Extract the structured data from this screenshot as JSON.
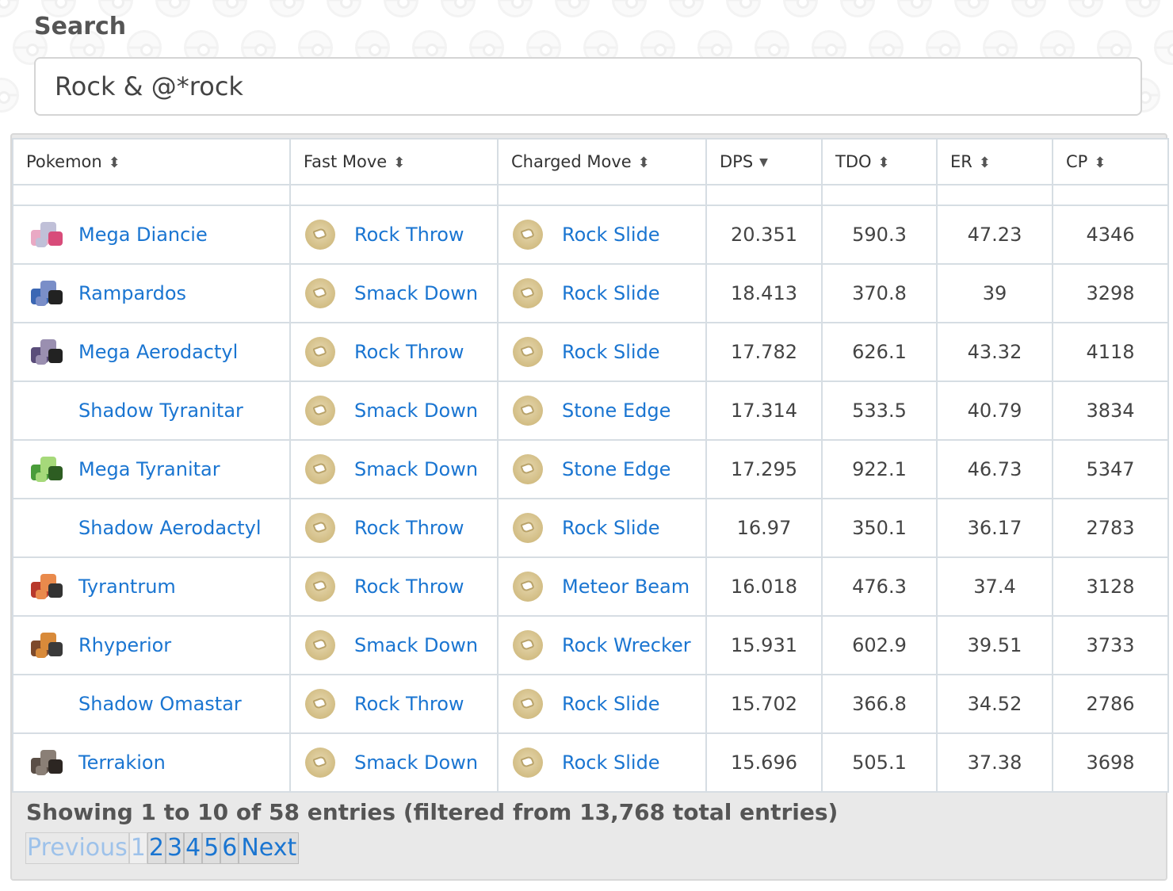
{
  "search": {
    "label": "Search",
    "value": "Rock & @*rock"
  },
  "table": {
    "headers": [
      {
        "label": "Pokemon",
        "sort": "both"
      },
      {
        "label": "Fast Move",
        "sort": "both"
      },
      {
        "label": "Charged Move",
        "sort": "both"
      },
      {
        "label": "DPS",
        "sort": "desc"
      },
      {
        "label": "TDO",
        "sort": "both"
      },
      {
        "label": "ER",
        "sort": "both"
      },
      {
        "label": "CP",
        "sort": "both"
      }
    ],
    "move_type_icon": "rock-type-icon",
    "rows": [
      {
        "pokemon": "Mega Diancie",
        "sprite": true,
        "fast": "Rock Throw",
        "charged": "Rock Slide",
        "dps": "20.351",
        "tdo": "590.3",
        "er": "47.23",
        "cp": "4346"
      },
      {
        "pokemon": "Rampardos",
        "sprite": true,
        "fast": "Smack Down",
        "charged": "Rock Slide",
        "dps": "18.413",
        "tdo": "370.8",
        "er": "39",
        "cp": "3298"
      },
      {
        "pokemon": "Mega Aerodactyl",
        "sprite": true,
        "fast": "Rock Throw",
        "charged": "Rock Slide",
        "dps": "17.782",
        "tdo": "626.1",
        "er": "43.32",
        "cp": "4118"
      },
      {
        "pokemon": "Shadow Tyranitar",
        "sprite": false,
        "fast": "Smack Down",
        "charged": "Stone Edge",
        "dps": "17.314",
        "tdo": "533.5",
        "er": "40.79",
        "cp": "3834"
      },
      {
        "pokemon": "Mega Tyranitar",
        "sprite": true,
        "fast": "Smack Down",
        "charged": "Stone Edge",
        "dps": "17.295",
        "tdo": "922.1",
        "er": "46.73",
        "cp": "5347"
      },
      {
        "pokemon": "Shadow Aerodactyl",
        "sprite": false,
        "fast": "Rock Throw",
        "charged": "Rock Slide",
        "dps": "16.97",
        "tdo": "350.1",
        "er": "36.17",
        "cp": "2783"
      },
      {
        "pokemon": "Tyrantrum",
        "sprite": true,
        "fast": "Rock Throw",
        "charged": "Meteor Beam",
        "dps": "16.018",
        "tdo": "476.3",
        "er": "37.4",
        "cp": "3128"
      },
      {
        "pokemon": "Rhyperior",
        "sprite": true,
        "fast": "Smack Down",
        "charged": "Rock Wrecker",
        "dps": "15.931",
        "tdo": "602.9",
        "er": "39.51",
        "cp": "3733"
      },
      {
        "pokemon": "Shadow Omastar",
        "sprite": false,
        "fast": "Rock Throw",
        "charged": "Rock Slide",
        "dps": "15.702",
        "tdo": "366.8",
        "er": "34.52",
        "cp": "2786"
      },
      {
        "pokemon": "Terrakion",
        "sprite": true,
        "fast": "Smack Down",
        "charged": "Rock Slide",
        "dps": "15.696",
        "tdo": "505.1",
        "er": "37.38",
        "cp": "3698"
      }
    ]
  },
  "info": "Showing 1 to 10 of 58 entries (filtered from 13,768 total entries)",
  "pagination": {
    "previous": "Previous",
    "pages": [
      "1",
      "2",
      "3",
      "4",
      "5",
      "6"
    ],
    "current": "1",
    "next": "Next"
  }
}
